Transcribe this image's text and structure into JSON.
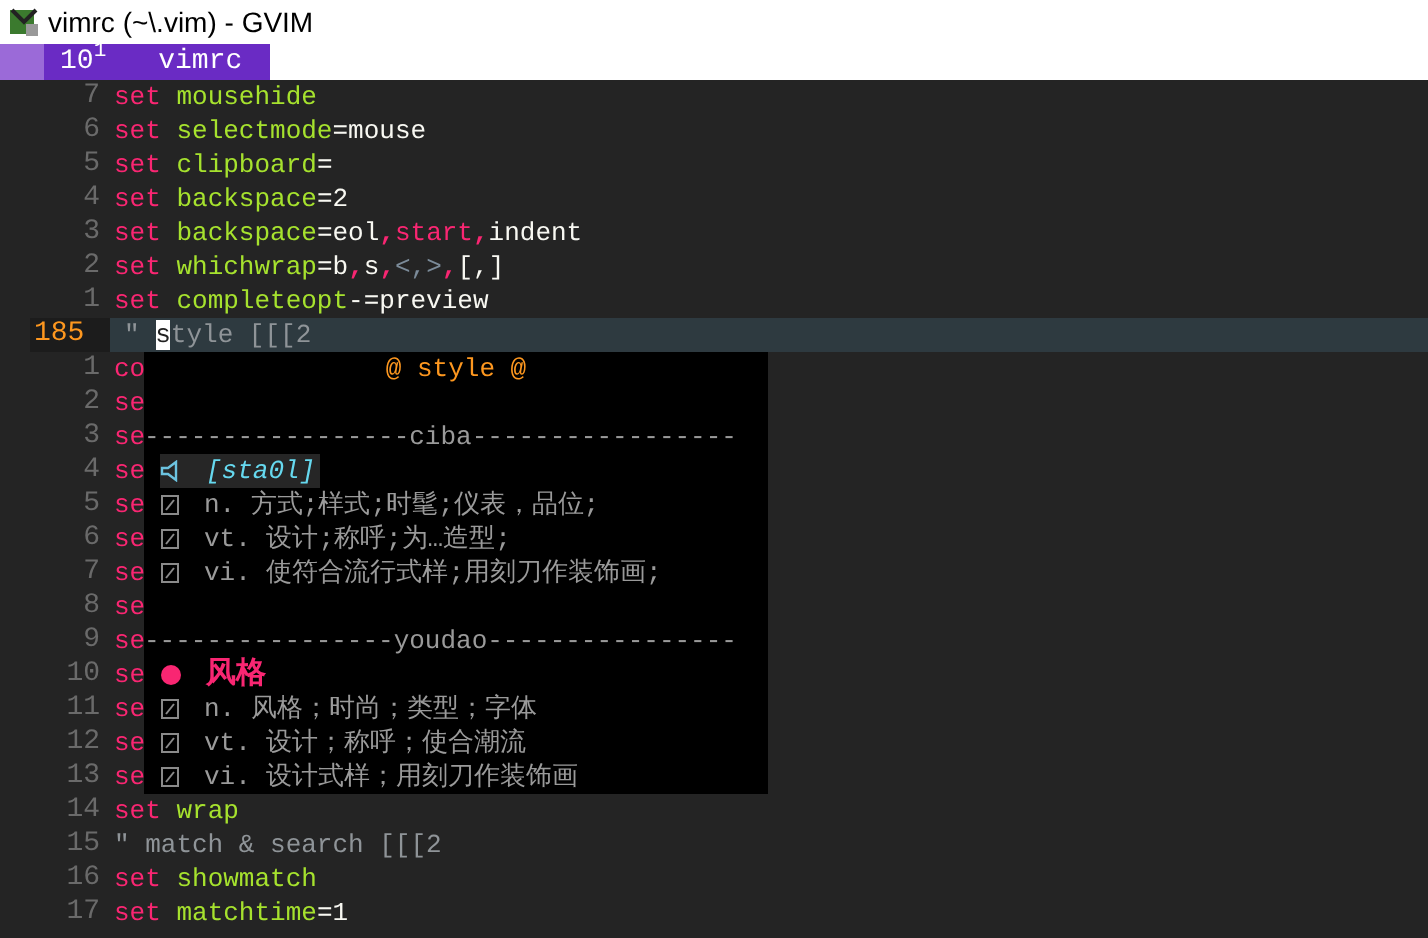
{
  "window": {
    "title": "vimrc (~\\.vim) - GVIM"
  },
  "tabline": {
    "tabs": [
      {
        "number": "10$^{1}$",
        "label": "vimrc",
        "selected": true
      }
    ]
  },
  "editor": {
    "lines": [
      {
        "number": "7",
        "current": false,
        "segments": [
          {
            "text": "set ",
            "kind": "keyword"
          },
          {
            "text": "mousehide",
            "kind": "option"
          }
        ]
      },
      {
        "number": "6",
        "current": false,
        "segments": [
          {
            "text": "set ",
            "kind": "keyword"
          },
          {
            "text": "selectmode",
            "kind": "option"
          },
          {
            "text": "=",
            "kind": "op"
          },
          {
            "text": "mouse",
            "kind": "value"
          }
        ]
      },
      {
        "number": "5",
        "current": false,
        "segments": [
          {
            "text": "set ",
            "kind": "keyword"
          },
          {
            "text": "clipboard",
            "kind": "option"
          },
          {
            "text": "=",
            "kind": "op"
          }
        ]
      },
      {
        "number": "4",
        "current": false,
        "segments": [
          {
            "text": "set ",
            "kind": "keyword"
          },
          {
            "text": "backspace",
            "kind": "option"
          },
          {
            "text": "=",
            "kind": "op"
          },
          {
            "text": "2",
            "kind": "value"
          }
        ]
      },
      {
        "number": "3",
        "current": false,
        "segments": [
          {
            "text": "set ",
            "kind": "keyword"
          },
          {
            "text": "backspace",
            "kind": "option"
          },
          {
            "text": "=",
            "kind": "op"
          },
          {
            "text": "eol",
            "kind": "value"
          },
          {
            "text": ",",
            "kind": "sep"
          },
          {
            "text": "start",
            "kind": "keyword"
          },
          {
            "text": ",",
            "kind": "sep"
          },
          {
            "text": "indent",
            "kind": "value"
          }
        ]
      },
      {
        "number": "2",
        "current": false,
        "segments": [
          {
            "text": "set ",
            "kind": "keyword"
          },
          {
            "text": "whichwrap",
            "kind": "option"
          },
          {
            "text": "=",
            "kind": "op"
          },
          {
            "text": "b",
            "kind": "value"
          },
          {
            "text": ",",
            "kind": "sep"
          },
          {
            "text": "s",
            "kind": "value"
          },
          {
            "text": ",",
            "kind": "sep"
          },
          {
            "text": "<,>",
            "kind": "dim"
          },
          {
            "text": ",",
            "kind": "sep"
          },
          {
            "text": "[,]",
            "kind": "value"
          }
        ]
      },
      {
        "number": "1",
        "current": false,
        "segments": [
          {
            "text": "set ",
            "kind": "keyword"
          },
          {
            "text": "completeopt",
            "kind": "option"
          },
          {
            "text": "-=",
            "kind": "op"
          },
          {
            "text": "preview",
            "kind": "value"
          }
        ]
      },
      {
        "number": "185",
        "current": true,
        "segments": [
          {
            "text": "\" ",
            "kind": "comment"
          },
          {
            "text": "s",
            "kind": "cursor"
          },
          {
            "text": "tyle [[[2",
            "kind": "comment"
          }
        ]
      },
      {
        "number": "1",
        "current": false,
        "segments": [
          {
            "text": "co",
            "kind": "keyword"
          }
        ]
      },
      {
        "number": "2",
        "current": false,
        "segments": [
          {
            "text": "se",
            "kind": "keyword"
          }
        ]
      },
      {
        "number": "3",
        "current": false,
        "segments": [
          {
            "text": "se",
            "kind": "keyword"
          }
        ]
      },
      {
        "number": "4",
        "current": false,
        "segments": [
          {
            "text": "se",
            "kind": "keyword"
          }
        ]
      },
      {
        "number": "5",
        "current": false,
        "segments": [
          {
            "text": "se",
            "kind": "keyword"
          }
        ]
      },
      {
        "number": "6",
        "current": false,
        "segments": [
          {
            "text": "se",
            "kind": "keyword"
          }
        ]
      },
      {
        "number": "7",
        "current": false,
        "segments": [
          {
            "text": "se",
            "kind": "keyword"
          }
        ]
      },
      {
        "number": "8",
        "current": false,
        "segments": [
          {
            "text": "se",
            "kind": "keyword"
          }
        ]
      },
      {
        "number": "9",
        "current": false,
        "segments": [
          {
            "text": "se",
            "kind": "keyword"
          }
        ]
      },
      {
        "number": "10",
        "current": false,
        "segments": [
          {
            "text": "se",
            "kind": "keyword"
          }
        ]
      },
      {
        "number": "11",
        "current": false,
        "segments": [
          {
            "text": "se",
            "kind": "keyword"
          }
        ]
      },
      {
        "number": "12",
        "current": false,
        "segments": [
          {
            "text": "se",
            "kind": "keyword"
          }
        ]
      },
      {
        "number": "13",
        "current": false,
        "segments": [
          {
            "text": "se",
            "kind": "keyword"
          }
        ]
      },
      {
        "number": "14",
        "current": false,
        "segments": [
          {
            "text": "set ",
            "kind": "keyword"
          },
          {
            "text": "wrap",
            "kind": "option"
          }
        ]
      },
      {
        "number": "15",
        "current": false,
        "segments": [
          {
            "text": "\" match & search [[[2",
            "kind": "comment"
          }
        ]
      },
      {
        "number": "16",
        "current": false,
        "segments": [
          {
            "text": "set ",
            "kind": "keyword"
          },
          {
            "text": "showmatch",
            "kind": "option"
          }
        ]
      },
      {
        "number": "17",
        "current": false,
        "segments": [
          {
            "text": "set ",
            "kind": "keyword"
          },
          {
            "text": "matchtime",
            "kind": "option"
          },
          {
            "text": "=",
            "kind": "op"
          },
          {
            "text": "1",
            "kind": "value"
          }
        ]
      }
    ]
  },
  "completion_popup": {
    "title": "@ style @",
    "sections": [
      {
        "divider": "-----------------ciba-----------------",
        "entries": [
          {
            "kind": "phonetic",
            "text": "[sta0l]"
          },
          {
            "kind": "definition",
            "text": "n. 方式;样式;时髦;仪表，品位;"
          },
          {
            "kind": "definition",
            "text": "vt. 设计;称呼;为…造型;"
          },
          {
            "kind": "definition",
            "text": "vi. 使符合流行式样;用刻刀作装饰画;"
          }
        ]
      },
      {
        "divider": "----------------youdao----------------",
        "entries": [
          {
            "kind": "headword",
            "text": "风格"
          },
          {
            "kind": "definition",
            "text": "n. 风格；时尚；类型；字体"
          },
          {
            "kind": "definition",
            "text": "vt. 设计；称呼；使合潮流"
          },
          {
            "kind": "definition",
            "text": "vi. 设计式样；用刻刀作装饰画"
          }
        ]
      }
    ]
  }
}
